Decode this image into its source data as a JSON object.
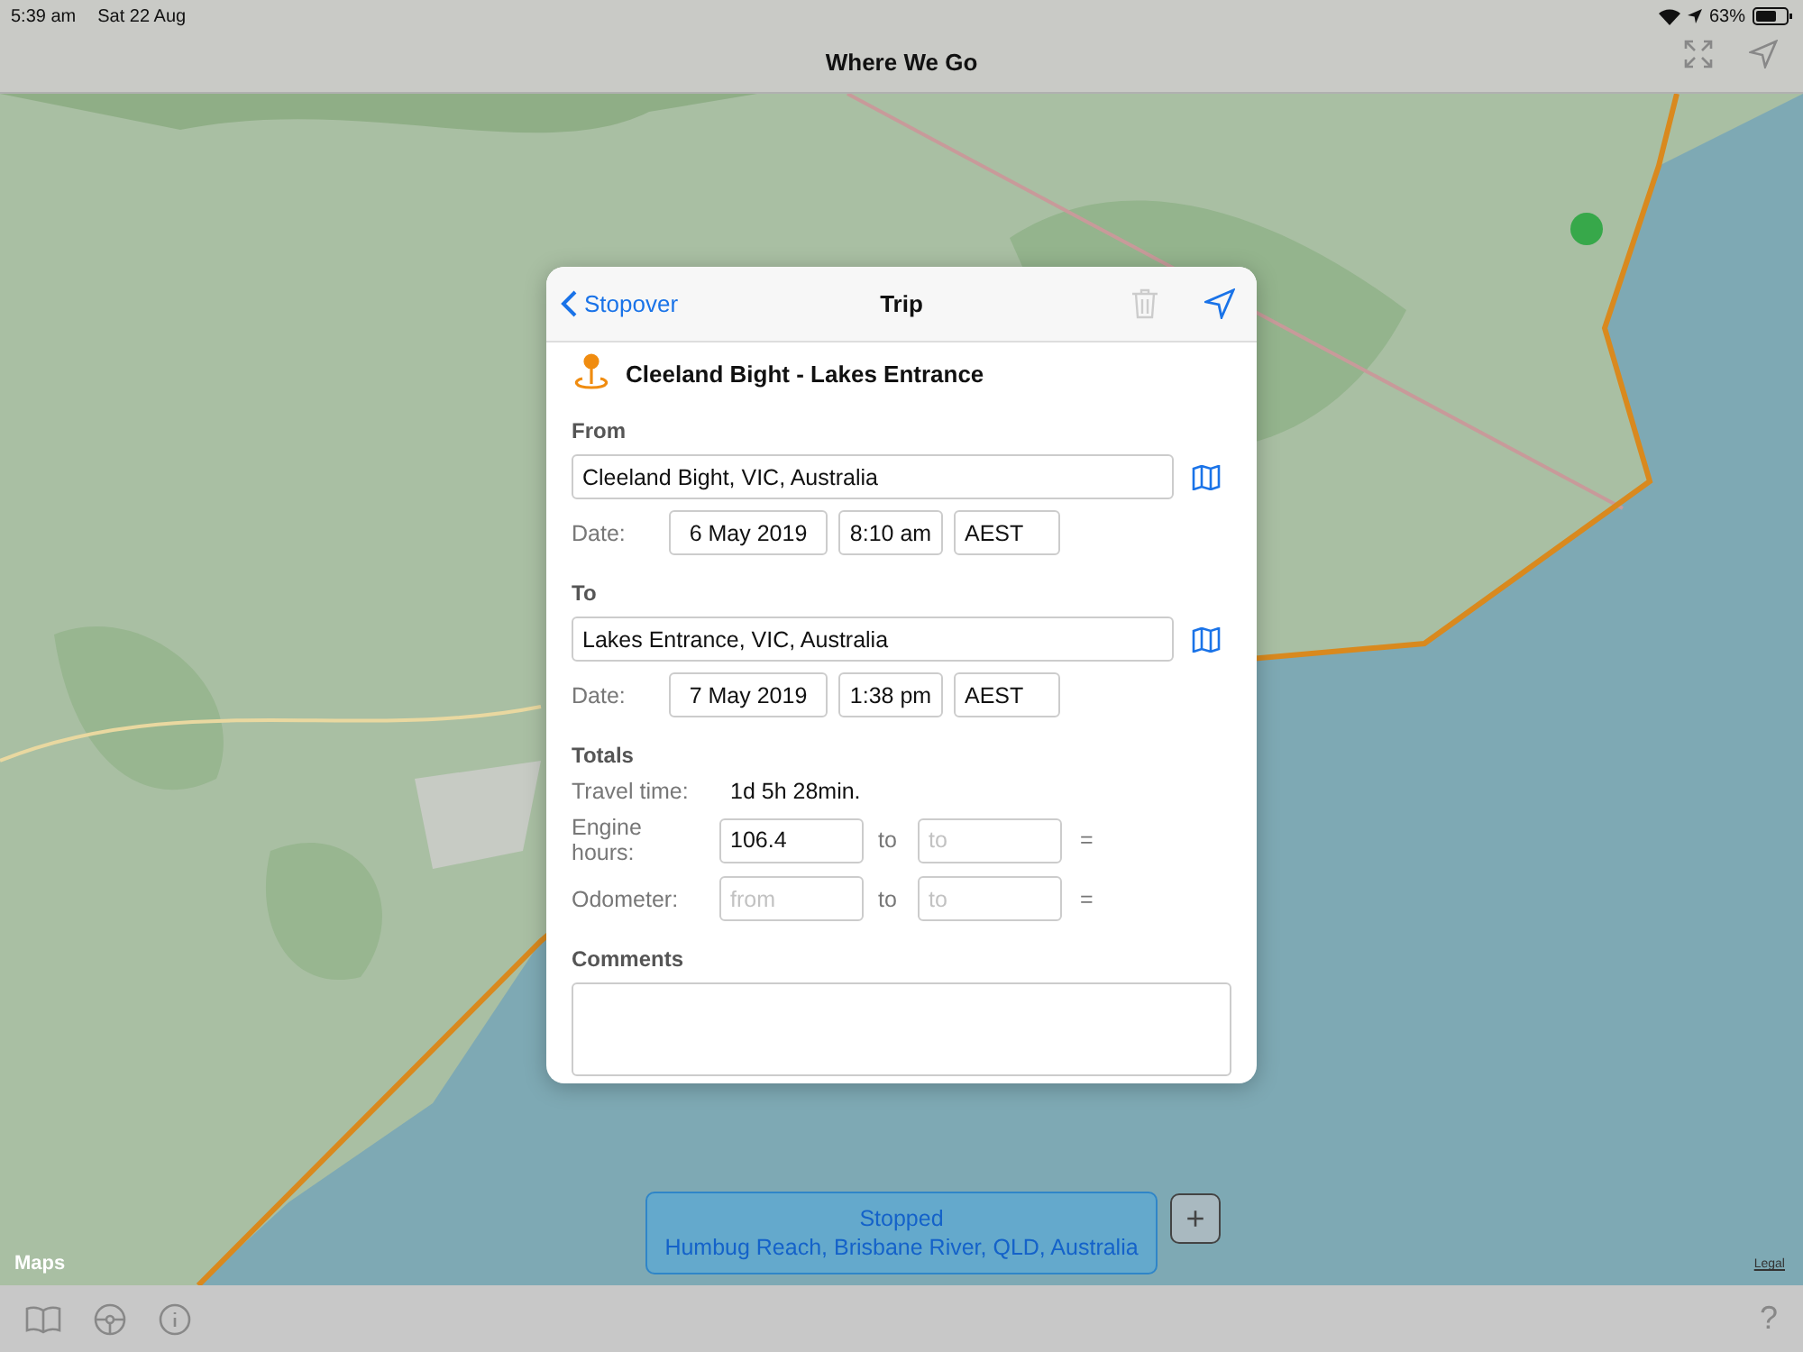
{
  "status_bar": {
    "time": "5:39 am",
    "date": "Sat 22 Aug",
    "battery": "63%"
  },
  "nav_bar": {
    "title": "Where We Go"
  },
  "map": {
    "kind": "picture",
    "attribution": "Maps",
    "legal": "Legal"
  },
  "trip_dialog": {
    "back_label": "Stopover",
    "title": "Trip",
    "trip_name": "Cleeland Bight - Lakes Entrance",
    "legs": [
      {
        "heading": "From",
        "place": "Cleeland Bight, VIC, Australia",
        "date_label": "Date:",
        "date": "6 May 2019",
        "time": "8:10 am",
        "timezone": "AEST"
      },
      {
        "heading": "To",
        "place": "Lakes Entrance, VIC, Australia",
        "date_label": "Date:",
        "date": "7 May 2019",
        "time": "1:38 pm",
        "timezone": "AEST"
      }
    ],
    "totals": {
      "heading": "Totals",
      "travel_time_label": "Travel time:",
      "travel_time": "1d 5h 28min.",
      "rows": [
        {
          "label": "Engine hours:",
          "from_value": "106.4",
          "to_label": "to",
          "to_placeholder": "to",
          "equals": "="
        },
        {
          "label": "Odometer:",
          "from_placeholder": "from",
          "to_label": "to",
          "to_placeholder": "to",
          "equals": "="
        }
      ]
    },
    "comments": {
      "heading": "Comments"
    }
  },
  "stopped_banner": {
    "status": "Stopped",
    "place": "Humbug Reach, Brisbane River, QLD, Australia",
    "add_label": "+"
  },
  "toolbar": {
    "help_label": "?"
  }
}
